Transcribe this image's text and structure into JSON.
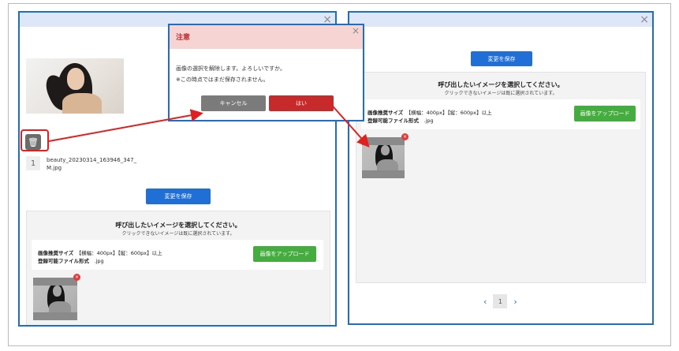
{
  "left_panel": {
    "close_label": "×",
    "delete_icon": "trash-icon",
    "index": "1",
    "filename_line1": "beauty_20230314_163946_347_",
    "filename_line2": "M.jpg",
    "save_label": "変更を保存",
    "select_title": "呼び出したいイメージを選択してください。",
    "select_sub": "クリックできないイメージは既に選択されています。",
    "size_label": "画像推奨サイズ",
    "size_value": "【横幅：400px】【縦：600px】以上",
    "format_label": "登録可能ファイル形式",
    "format_value": ".jpg",
    "upload_label": "画像をアップロード",
    "remove_badge": "×"
  },
  "dialog": {
    "title": "注意",
    "close_label": "×",
    "message_line1": "画像の選択を解除します。よろしいですか。",
    "message_line2": "※この時点ではまだ保存されません。",
    "cancel_label": "キャンセル",
    "ok_label": "はい"
  },
  "right_panel": {
    "close_label": "×",
    "save_label": "変更を保存",
    "select_title": "呼び出したいイメージを選択してください。",
    "select_sub": "クリックできないイメージは既に選択されています。",
    "size_label": "画像推奨サイズ",
    "size_value": "【横幅：400px】【縦：600px】以上",
    "format_label": "登録可能ファイル形式",
    "format_value": ".jpg",
    "upload_label": "画像をアップロード",
    "remove_badge": "×",
    "pager_prev": "‹",
    "pager_page": "1",
    "pager_next": "›"
  },
  "colors": {
    "panel_border": "#1f6fc1",
    "save_button": "#1f6fd6",
    "upload_button": "#45ad3f",
    "ok_button": "#c72a2a",
    "cancel_button": "#7b7b7b",
    "annotation": "#e02020"
  }
}
